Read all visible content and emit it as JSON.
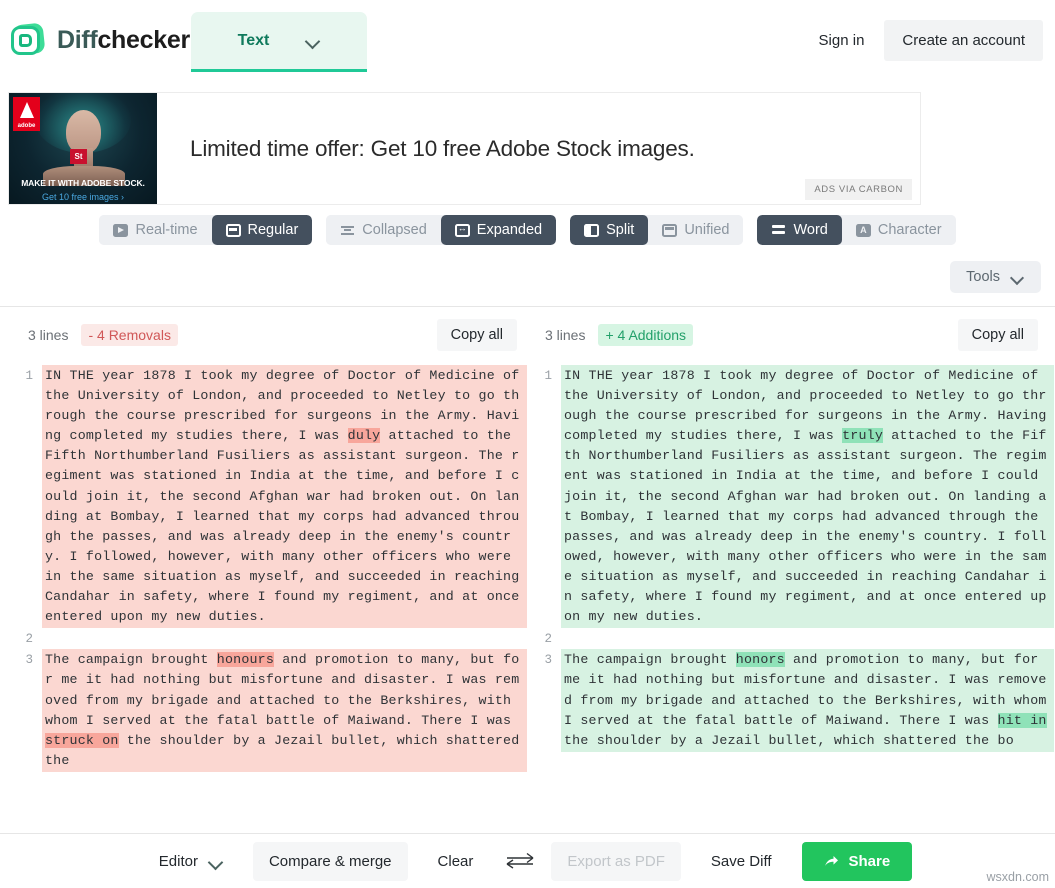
{
  "header": {
    "brand_first": "Diff",
    "brand_second": "checker",
    "logo_icon": "diffchecker-logo-icon",
    "type_selector": {
      "label": "Text",
      "chevron_icon": "chevron-down-icon"
    },
    "sign_in": "Sign in",
    "create_account": "Create an account"
  },
  "ad": {
    "headline": "Limited time offer: Get 10 free Adobe Stock images.",
    "carbon_label": "ADS VIA CARBON",
    "thumb": {
      "brand_mark": "adobe",
      "stock_mark": "St",
      "caption_line1": "MAKE IT WITH ADOBE STOCK.",
      "caption_line2": "Get 10 free images ›"
    }
  },
  "options": {
    "row1": [
      {
        "label": "Real-time",
        "icon": "play-icon",
        "active": false
      },
      {
        "label": "Regular",
        "icon": "window-icon",
        "active": true
      }
    ],
    "row2": [
      {
        "label": "Collapsed",
        "icon": "collapse-icon",
        "active": false
      },
      {
        "label": "Expanded",
        "icon": "expand-icon",
        "active": true
      }
    ],
    "row3": [
      {
        "label": "Split",
        "icon": "split-view-icon",
        "active": true
      },
      {
        "label": "Unified",
        "icon": "unified-view-icon",
        "active": false
      }
    ],
    "row4": [
      {
        "label": "Word",
        "icon": "word-diff-icon",
        "active": true
      },
      {
        "label": "Character",
        "icon": "character-diff-icon",
        "active": false
      }
    ],
    "tools": {
      "label": "Tools",
      "chevron_icon": "chevron-down-icon"
    }
  },
  "stats": {
    "left": {
      "lines": "3 lines",
      "chip": "- 4 Removals",
      "copy_all": "Copy all"
    },
    "right": {
      "lines": "3 lines",
      "chip": "+ 4 Additions",
      "copy_all": "Copy all"
    }
  },
  "diff": {
    "left": [
      {
        "num": "1",
        "kind": "del",
        "parts": [
          {
            "t": "IN THE year 1878 I took my degree of Doctor of Medicine of the University of London, and proceeded to Netley to go through the course prescribed for surgeons in the Army. Having completed my studies there, I was ",
            "h": false
          },
          {
            "t": "duly",
            "h": true
          },
          {
            "t": " attached to the Fifth Northumberland Fusiliers as assistant surgeon. The regiment was stationed in India at the time, and before I could join it, the second Afghan war had broken out. On landing at Bombay, I learned that my corps had advanced through the passes, and was already deep in the enemy's country. I followed, however, with many other officers who were in the same situation as myself, and succeeded in reaching Candahar in safety, where I found my regiment, and at once entered upon my new duties.",
            "h": false
          }
        ]
      },
      {
        "num": "2",
        "kind": "empty",
        "parts": [
          {
            "t": "",
            "h": false
          }
        ]
      },
      {
        "num": "3",
        "kind": "del",
        "parts": [
          {
            "t": "The campaign brought ",
            "h": false
          },
          {
            "t": "honours",
            "h": true
          },
          {
            "t": " and promotion to many, but for me it had nothing but misfortune and disaster. I was removed from my brigade and attached to the Berkshires, with whom I served at the fatal battle of Maiwand. There I was ",
            "h": false
          },
          {
            "t": "struck on",
            "h": true
          },
          {
            "t": " the shoulder by a Jezail bullet, which shattered the",
            "h": false
          }
        ]
      }
    ],
    "right": [
      {
        "num": "1",
        "kind": "ins",
        "parts": [
          {
            "t": "IN THE year 1878 I took my degree of Doctor of Medicine of the University of London, and proceeded to Netley to go through the course prescribed for surgeons in the Army. Having completed my studies there, I was ",
            "h": false
          },
          {
            "t": "truly",
            "h": true
          },
          {
            "t": " attached to the Fifth Northumberland Fusiliers as assistant surgeon. The regiment was stationed in India at the time, and before I could join it, the second Afghan war had broken out. On landing at Bombay, I learned that my corps had advanced through the passes, and was already deep in the enemy's country. I followed, however, with many other officers who were in the same situation as myself, and succeeded in reaching Candahar in safety, where I found my regiment, and at once entered upon my new duties.",
            "h": false
          }
        ]
      },
      {
        "num": "2",
        "kind": "empty",
        "parts": [
          {
            "t": "",
            "h": false
          }
        ]
      },
      {
        "num": "3",
        "kind": "ins",
        "parts": [
          {
            "t": "The campaign brought ",
            "h": false
          },
          {
            "t": "honors",
            "h": true
          },
          {
            "t": " and promotion to many, but for me it had nothing but misfortune and disaster. I was removed from my brigade and attached to the Berkshires, with whom I served at the fatal battle of Maiwand. There I was ",
            "h": false
          },
          {
            "t": "hit in",
            "h": true
          },
          {
            "t": " the shoulder by a Jezail bullet, which shattered the bo",
            "h": false
          }
        ]
      }
    ]
  },
  "bottom": {
    "editor": {
      "label": "Editor",
      "chevron_icon": "chevron-down-icon"
    },
    "compare_merge": "Compare & merge",
    "clear": "Clear",
    "swap_icon": "swap-arrows-icon",
    "export_pdf": "Export as PDF",
    "save_diff": "Save Diff",
    "share": {
      "label": "Share",
      "icon": "share-arrow-icon"
    }
  },
  "watermark": "wsxdn.com",
  "colors": {
    "accent_green": "#22c55e",
    "tab_green": "#20c997",
    "removal_bg": "#fbd7d1",
    "removal_hl": "#f8a69b",
    "addition_bg": "#d7f2e2",
    "addition_hl": "#8fe2b8",
    "seg_active": "#44505e"
  }
}
